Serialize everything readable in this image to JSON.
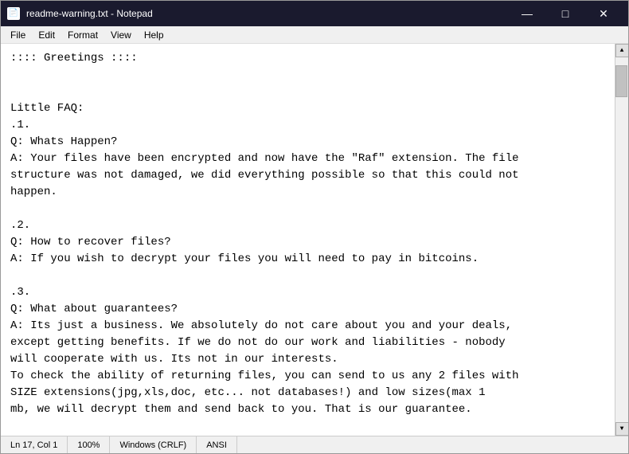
{
  "window": {
    "title": "readme-warning.txt - Notepad",
    "icon": "📄"
  },
  "titlebar": {
    "minimize": "—",
    "maximize": "□",
    "close": "✕"
  },
  "menu": {
    "items": [
      "File",
      "Edit",
      "Format",
      "View",
      "Help"
    ]
  },
  "content": {
    "text": ":::: Greetings ::::\n\n\nLittle FAQ:\n.1.\nQ: Whats Happen?\nA: Your files have been encrypted and now have the \"Raf\" extension. The file\nstructure was not damaged, we did everything possible so that this could not\nhappen.\n\n.2.\nQ: How to recover files?\nA: If you wish to decrypt your files you will need to pay in bitcoins.\n\n.3.\nQ: What about guarantees?\nA: Its just a business. We absolutely do not care about you and your deals,\nexcept getting benefits. If we do not do our work and liabilities - nobody\nwill cooperate with us. Its not in our interests.\nTo check the ability of returning files, you can send to us any 2 files with\nSIZE extensions(jpg,xls,doc, etc... not databases!) and low sizes(max 1\nmb, we will decrypt them and send back to you. That is our guarantee."
  },
  "statusbar": {
    "position": "Ln 17, Col 1",
    "zoom": "100%",
    "line_ending": "Windows (CRLF)",
    "encoding": "ANSI"
  }
}
